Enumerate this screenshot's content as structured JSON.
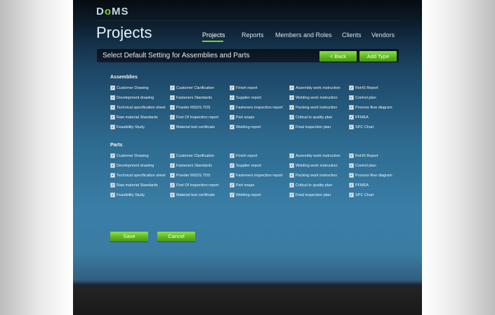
{
  "app": {
    "logo": "DoMS",
    "page_title": "Projects"
  },
  "nav": {
    "items": [
      {
        "label": "Projects",
        "active": true
      },
      {
        "label": "Reports",
        "active": false
      },
      {
        "label": "Members and Roles",
        "active": false
      },
      {
        "label": "Clients",
        "active": false
      },
      {
        "label": "Vendors",
        "active": false
      }
    ]
  },
  "header": {
    "title": "Select Default Setting for Assemblies and Parts",
    "back_label": "< Back",
    "add_type_label": "Add Type"
  },
  "sections": [
    {
      "title": "Assemblies",
      "rows": [
        [
          "Customer Drawing",
          "Customer Clarification",
          "Finish report",
          "Assembly work instruction",
          "RoHS Report"
        ],
        [
          "Development drawing",
          "Fasteners Standards",
          "Supplier report",
          "Welding work instruction",
          "Control plan"
        ],
        [
          "Technical specification sheet",
          "Powder MSDS.TDS",
          "Fasteners inspection report",
          "Packing work instruction",
          "Process flow diagram"
        ],
        [
          "Raw material Standards",
          "First Of Inspection report",
          "Part snaps",
          "Critical to quality plan",
          "PFMEA"
        ],
        [
          "Feasibility Study",
          "Material test certificate",
          "Welding report",
          "Final inspection plan",
          "SPC Chart"
        ]
      ]
    },
    {
      "title": "Parts",
      "rows": [
        [
          "Customer Drawing",
          "Customer Clarification",
          "Finish report",
          "Assembly work instruction",
          "RoHS Report"
        ],
        [
          "Development drawing",
          "Fasteners Standards",
          "Supplier report",
          "Welding work instruction",
          "Control plan"
        ],
        [
          "Technical specification sheet",
          "Powder MSDS.TDS",
          "Fasteners inspection report",
          "Packing work instruction",
          "Process flow diagram"
        ],
        [
          "Raw material Standards",
          "First Of Inspection report",
          "Part snaps",
          "Critical to quality plan",
          "PFMEA"
        ],
        [
          "Feasibility Study",
          "Material test certificate",
          "Welding report",
          "Final inspection plan",
          "SPC Chart"
        ]
      ]
    }
  ],
  "actions": {
    "save_label": "Save",
    "cancel_label": "Cancel"
  },
  "colors": {
    "accent": "#6cc52a",
    "panel": "#2d6a8f",
    "header_bar": "#0b1723"
  },
  "icons": {
    "checkbox": "checkbox-checked-icon"
  }
}
